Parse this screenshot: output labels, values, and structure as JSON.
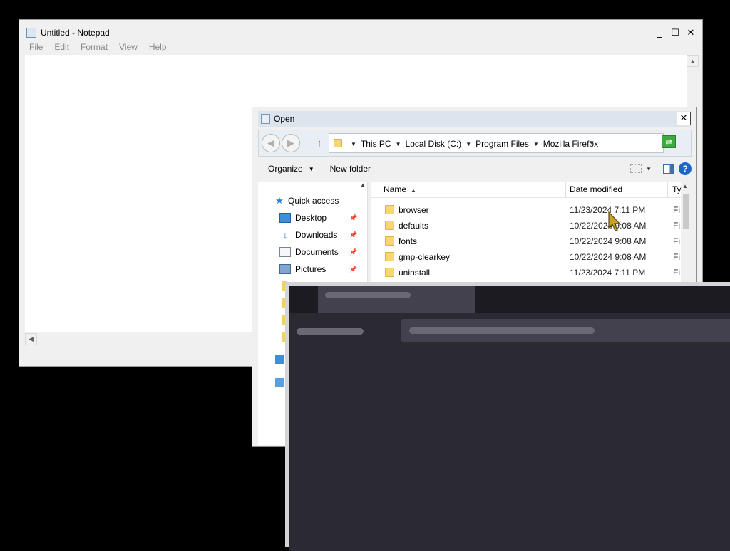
{
  "notepad": {
    "title": "Untitled - Notepad",
    "menu": [
      "File",
      "Edit",
      "Format",
      "View",
      "Help"
    ],
    "controls": {
      "minimize": "_",
      "maximize": "☐",
      "close": "✕"
    }
  },
  "dialog": {
    "title": "Open",
    "close": "✕",
    "breadcrumb": [
      "This PC",
      "Local Disk (C:)",
      "Program Files",
      "Mozilla Firefox"
    ],
    "toolbar": {
      "organize": "Organize",
      "new_folder": "New folder",
      "help": "?"
    },
    "nav": [
      {
        "label": "Quick access",
        "icon": "star-icon"
      },
      {
        "label": "Desktop",
        "icon": "desktop-icon",
        "pinned": true
      },
      {
        "label": "Downloads",
        "icon": "download-icon",
        "pinned": true
      },
      {
        "label": "Documents",
        "icon": "documents-icon",
        "pinned": true
      },
      {
        "label": "Pictures",
        "icon": "pictures-icon",
        "pinned": true
      }
    ],
    "columns": {
      "name": "Name",
      "date": "Date modified",
      "type": "Ty"
    },
    "files": [
      {
        "name": "browser",
        "date": "11/23/2024 7:11 PM",
        "type": "Fi"
      },
      {
        "name": "defaults",
        "date": "10/22/2024 9:08 AM",
        "type": "Fi"
      },
      {
        "name": "fonts",
        "date": "10/22/2024 9:08 AM",
        "type": "Fi"
      },
      {
        "name": "gmp-clearkey",
        "date": "10/22/2024 9:08 AM",
        "type": "Fi"
      },
      {
        "name": "uninstall",
        "date": "11/23/2024 7:11 PM",
        "type": "Fi"
      }
    ]
  },
  "colors": {
    "dark_window_bg": "#2b2a33",
    "dark_tabstrip": "#1c1b22",
    "folder": "#f6d774",
    "accent_blue": "#1b67c9"
  }
}
